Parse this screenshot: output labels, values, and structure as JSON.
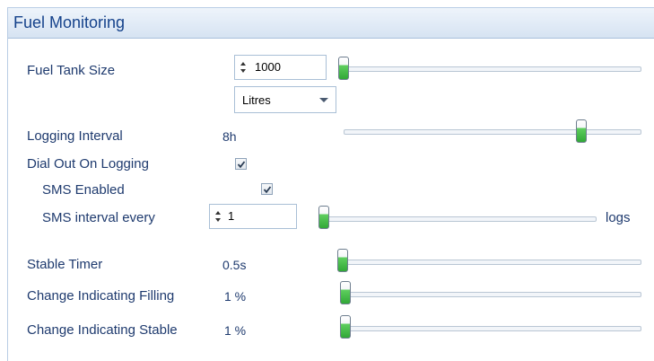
{
  "panel": {
    "title": "Fuel Monitoring"
  },
  "fuel_tank_size": {
    "label": "Fuel Tank Size",
    "value": "1000",
    "unit": "Litres"
  },
  "logging_interval": {
    "label": "Logging Interval",
    "value": "8h"
  },
  "dial_out": {
    "label": "Dial Out On Logging",
    "checked": true
  },
  "sms_enabled": {
    "label": "SMS Enabled",
    "checked": true
  },
  "sms_interval": {
    "label": "SMS interval every",
    "value": "1",
    "suffix": "logs"
  },
  "stable_timer": {
    "label": "Stable Timer",
    "value": "0.5s"
  },
  "change_filling": {
    "label": "Change Indicating Filling",
    "value": "1 %"
  },
  "change_stable": {
    "label": "Change Indicating Stable",
    "value": "1 %"
  },
  "colors": {
    "header_bg": "#d6e3f2",
    "title": "#15428b",
    "text": "#1e3a6e",
    "slider_thumb": "#31a837"
  },
  "icons": [
    "spin-arrows-icon",
    "dropdown-arrow-icon",
    "checkmark-icon"
  ]
}
